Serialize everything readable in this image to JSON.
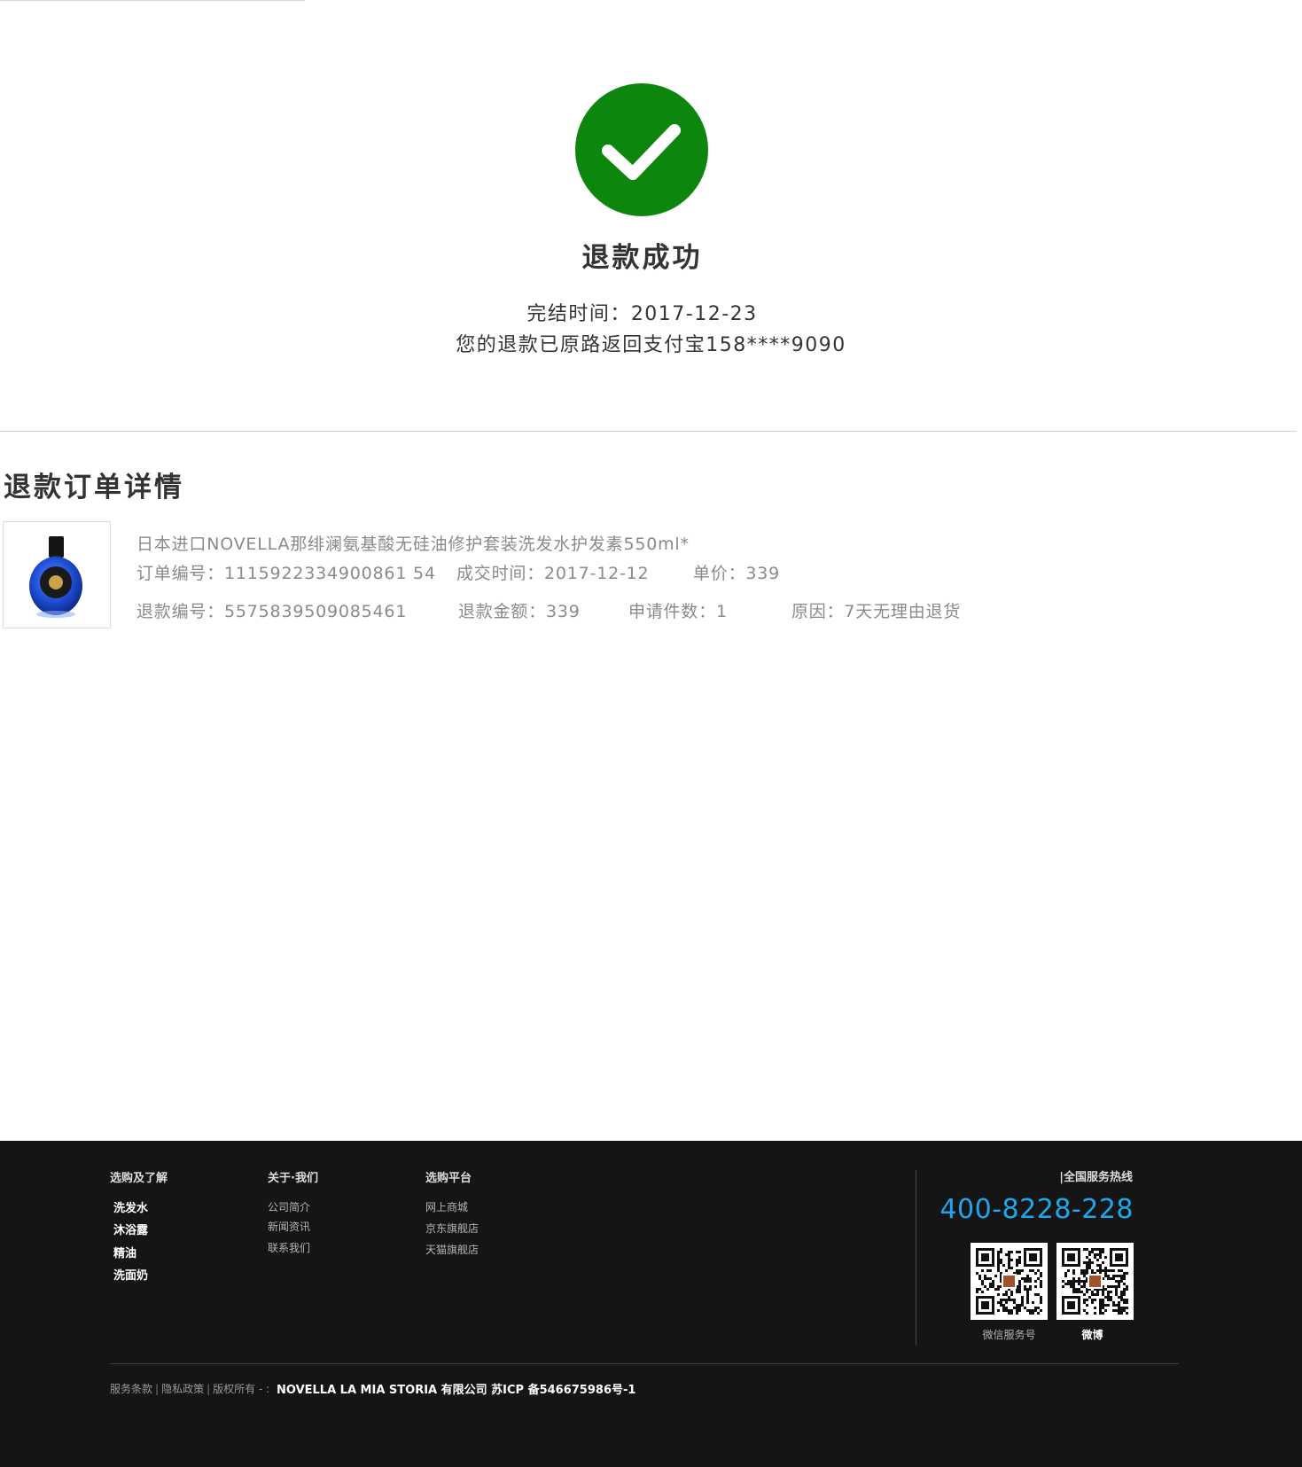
{
  "result": {
    "title": "退款成功",
    "finish_time": "完结时间：2017-12-23",
    "refund_note": "您的退款已原路返回支付宝158****9090",
    "icon": "check-circle-icon",
    "icon_color": "#0d860d"
  },
  "details": {
    "heading": "退款订单详情",
    "product_name": "日本进口NOVELLA那绯澜氨基酸无硅油修护套装洗发水护发素550ml*",
    "order_no": "订单编号：1115922334900861 54",
    "deal_time": "成交时间：2017-12-12",
    "unit_price": "单价：339",
    "refund_no": "退款编号：5575839509085461",
    "refund_amount": "退款金额：339",
    "quantity": "申请件数：1",
    "reason": "原因：7天无理由退货"
  },
  "footer": {
    "col1": {
      "heading": "选购及了解",
      "items": [
        "洗发水",
        "沐浴露",
        "精油",
        "洗面奶"
      ]
    },
    "col2": {
      "heading": "关于·我们",
      "items": [
        "公司简介",
        "新闻资讯",
        "联系我们"
      ]
    },
    "col3": {
      "heading": "选购平台",
      "items": [
        "网上商城",
        "京东旗舰店",
        "天猫旗舰店"
      ]
    },
    "hotline_label": "|全国服务热线",
    "hotline": "400-8228-228",
    "hotline_color": "#1ea7ec",
    "qr_captions": [
      "微信服务号",
      "微博"
    ],
    "links": [
      "服务条款",
      "隐私政策",
      "版权所有 - :"
    ],
    "company": "NOVELLA  LA MIA STORIA 有限公司 苏ICP 备546675986号-1"
  }
}
